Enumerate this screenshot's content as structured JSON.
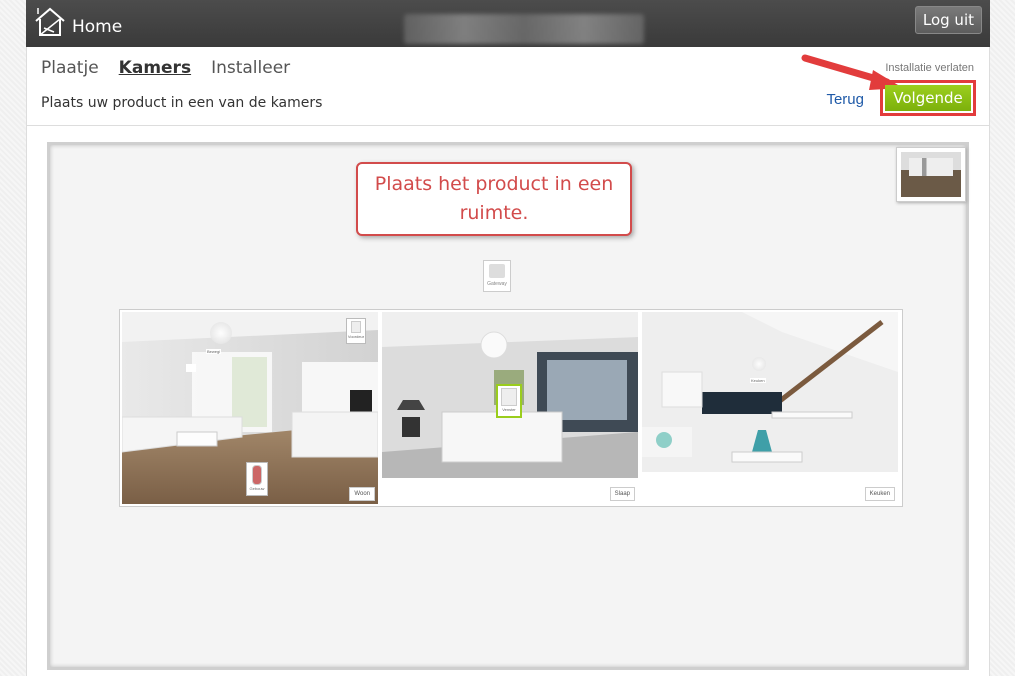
{
  "header": {
    "home_label": "Home",
    "logout_label": "Log uit"
  },
  "nav": {
    "tabs": [
      {
        "label": "Plaatje",
        "active": false
      },
      {
        "label": "Kamers",
        "active": true
      },
      {
        "label": "Installeer",
        "active": false
      }
    ],
    "instruction": "Plaats uw product in een van de kamers",
    "exit_label": "Installatie verlaten",
    "back_label": "Terug",
    "next_label": "Volgende"
  },
  "colors": {
    "accent_green": "#8cc016",
    "highlight_red": "#e23c3c",
    "link_blue": "#1f5aa8"
  },
  "canvas": {
    "callout": "Plaats het product in een ruimte.",
    "gateway_label": "Gateway"
  },
  "rooms": [
    {
      "label": "Woon",
      "devices": [
        {
          "label": "Voordeur"
        },
        {
          "label": "Bewegi"
        },
        {
          "label": "Gebouw"
        }
      ]
    },
    {
      "label": "Slaap",
      "devices": [
        {
          "label": "Venster"
        }
      ]
    },
    {
      "label": "Keuken",
      "devices": [
        {
          "label": "Keuken"
        }
      ]
    }
  ]
}
